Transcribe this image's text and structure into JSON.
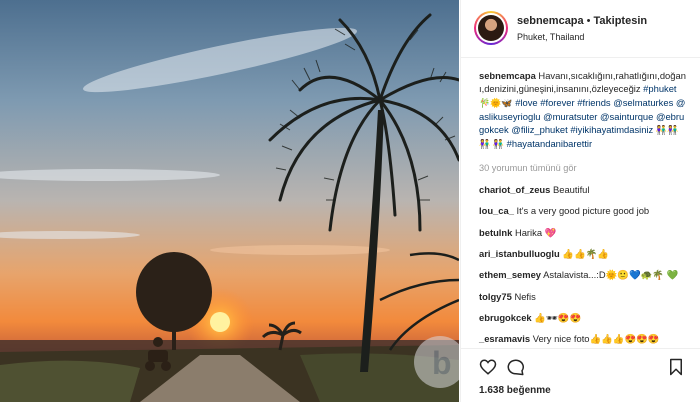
{
  "header": {
    "username": "sebnemcapa",
    "separator": "•",
    "follow_status": "Takiptesin",
    "location": "Phuket, Thailand"
  },
  "caption": {
    "user": "sebnemcapa",
    "text": "Havanı,sıcaklığını,rahatlığını,doğanı,denizini,güneşini,insanını,özleyeceğiz",
    "hashtag_phuket": "#phuket",
    "emoji_1": "🎋🌞🦋",
    "hashtags_1": "#love #forever #friends",
    "mentions_1": "@selmaturkes @aslikuseyrioglu",
    "mentions_2": "@muratsuter @sainturque @ebrugokcek",
    "mention_filiz": "@filiz_phuket",
    "hashtag_iyi": "#iyikihayatimdasiniz",
    "emoji_2": "👫👫👫",
    "emoji_3": "👫",
    "hashtag_hayat": "#hayatandanibarettir"
  },
  "view_all": "30 yorumun tümünü gör",
  "comments": [
    {
      "user": "chariot_of_zeus",
      "text": "Beautiful"
    },
    {
      "user": "lou_ca_",
      "text": "It's a very good picture good job"
    },
    {
      "user": "betulnk",
      "text": "Harika 💖"
    },
    {
      "user": "ari_istanbulluoglu",
      "text": "👍👍🌴👍"
    },
    {
      "user": "ethem_semey",
      "text": "Astalavista...:D🌞🙂💙🐢🌴 💚"
    },
    {
      "user": "tolgy75",
      "text": "Nefis"
    },
    {
      "user": "ebrugokcek",
      "text": "👍🕶😍😍"
    },
    {
      "user": "_esramavis",
      "text": "Very nice foto👍👍👍😍😍😍"
    }
  ],
  "likes": "1.638 beğenme",
  "watermark": "b",
  "colors": {
    "tag": "#003569",
    "text": "#262626",
    "muted": "#999999",
    "border": "#efefef"
  }
}
